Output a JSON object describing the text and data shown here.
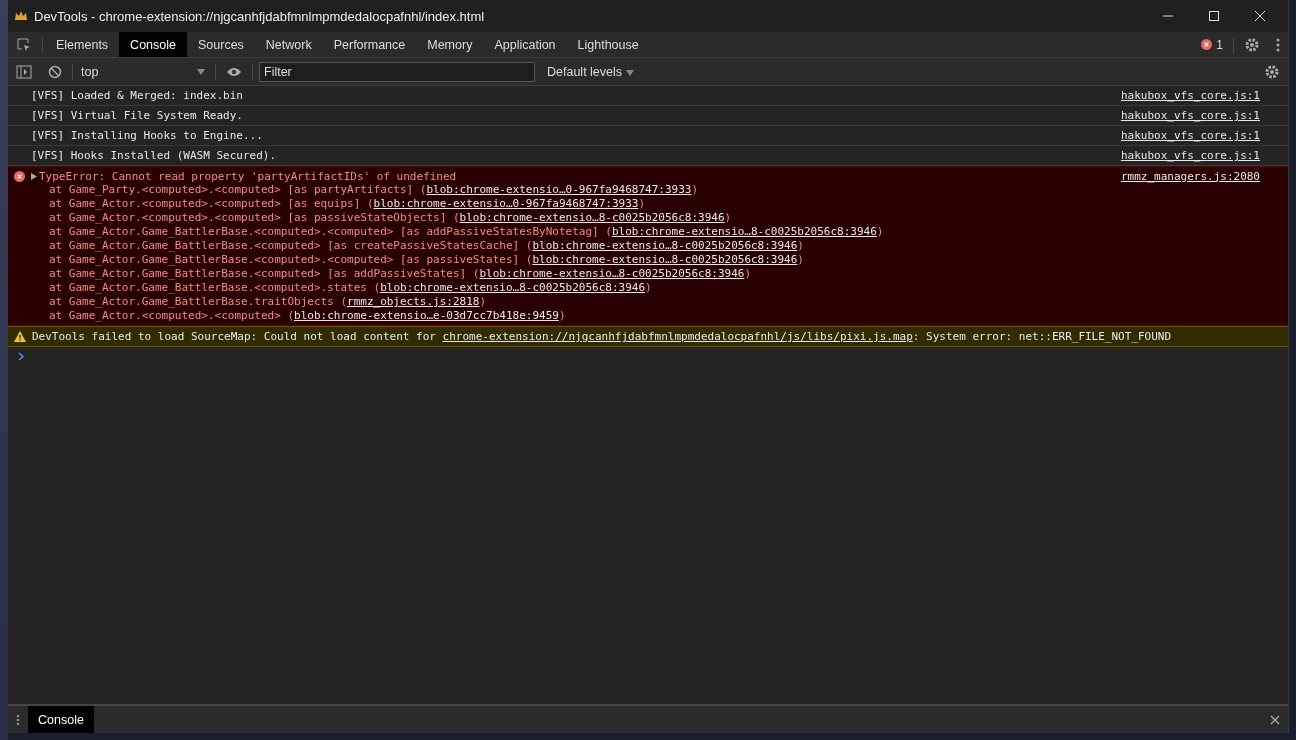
{
  "window": {
    "title": "DevTools - chrome-extension://njgcanhfjdabfmnlmpmdedalocpafnhl/index.html"
  },
  "tabs": [
    {
      "label": "Elements",
      "selected": false
    },
    {
      "label": "Console",
      "selected": true
    },
    {
      "label": "Sources",
      "selected": false
    },
    {
      "label": "Network",
      "selected": false
    },
    {
      "label": "Performance",
      "selected": false
    },
    {
      "label": "Memory",
      "selected": false
    },
    {
      "label": "Application",
      "selected": false
    },
    {
      "label": "Lighthouse",
      "selected": false
    }
  ],
  "error_count": "1",
  "toolbar": {
    "context": "top",
    "filter": {
      "placeholder": "Filter"
    },
    "levels": "Default levels"
  },
  "messages": [
    {
      "kind": "log",
      "text": "[VFS] Loaded & Merged: index.bin",
      "source": "hakubox_vfs_core.js:1"
    },
    {
      "kind": "log",
      "text": "[VFS] Virtual File System Ready.",
      "source": "hakubox_vfs_core.js:1"
    },
    {
      "kind": "log",
      "text": "[VFS] Installing Hooks to Engine...",
      "source": "hakubox_vfs_core.js:1"
    },
    {
      "kind": "log",
      "text": "[VFS] Hooks Installed (WASM Secured).",
      "source": "hakubox_vfs_core.js:1"
    },
    {
      "kind": "error",
      "expanded": false,
      "text": "TypeError: Cannot read property 'partyArtifactIDs' of undefined",
      "source": "rmmz_managers.js:2080",
      "stack": [
        {
          "text": "at Game_Party.<computed>.<computed> [as partyArtifacts] (",
          "link": "blob:chrome-extensio…0-967fa9468747:3933",
          "suffix": ")"
        },
        {
          "text": "at Game_Actor.<computed>.<computed> [as equips] (",
          "link": "blob:chrome-extensio…0-967fa9468747:3933",
          "suffix": ")"
        },
        {
          "text": "at Game_Actor.<computed>.<computed> [as passiveStateObjects] (",
          "link": "blob:chrome-extensio…8-c0025b2056c8:3946",
          "suffix": ")"
        },
        {
          "text": "at Game_Actor.Game_BattlerBase.<computed>.<computed> [as addPassiveStatesByNotetag] (",
          "link": "blob:chrome-extensio…8-c0025b2056c8:3946",
          "suffix": ")"
        },
        {
          "text": "at Game_Actor.Game_BattlerBase.<computed> [as createPassiveStatesCache] (",
          "link": "blob:chrome-extensio…8-c0025b2056c8:3946",
          "suffix": ")"
        },
        {
          "text": "at Game_Actor.Game_BattlerBase.<computed>.<computed> [as passiveStates] (",
          "link": "blob:chrome-extensio…8-c0025b2056c8:3946",
          "suffix": ")"
        },
        {
          "text": "at Game_Actor.Game_BattlerBase.<computed> [as addPassiveStates] (",
          "link": "blob:chrome-extensio…8-c0025b2056c8:3946",
          "suffix": ")"
        },
        {
          "text": "at Game_Actor.Game_BattlerBase.<computed>.states (",
          "link": "blob:chrome-extensio…8-c0025b2056c8:3946",
          "suffix": ")"
        },
        {
          "text": "at Game_Actor.Game_BattlerBase.traitObjects (",
          "link": "rmmz_objects.js:2818",
          "suffix": ")"
        },
        {
          "text": "at Game_Actor.<computed>.<computed> (",
          "link": "blob:chrome-extensio…e-03d7cc7b418e:9459",
          "suffix": ")"
        }
      ]
    },
    {
      "kind": "warning",
      "text": "DevTools failed to load SourceMap: Could not load content for ",
      "link": "chrome-extension://njgcanhfjdabfmnlmpmdedalocpafnhl/js/libs/pixi.js.map",
      "suffix": ": System error: net::ERR_FILE_NOT_FOUND"
    }
  ],
  "drawer": {
    "tabs": [
      {
        "label": "Console",
        "selected": true
      }
    ]
  }
}
